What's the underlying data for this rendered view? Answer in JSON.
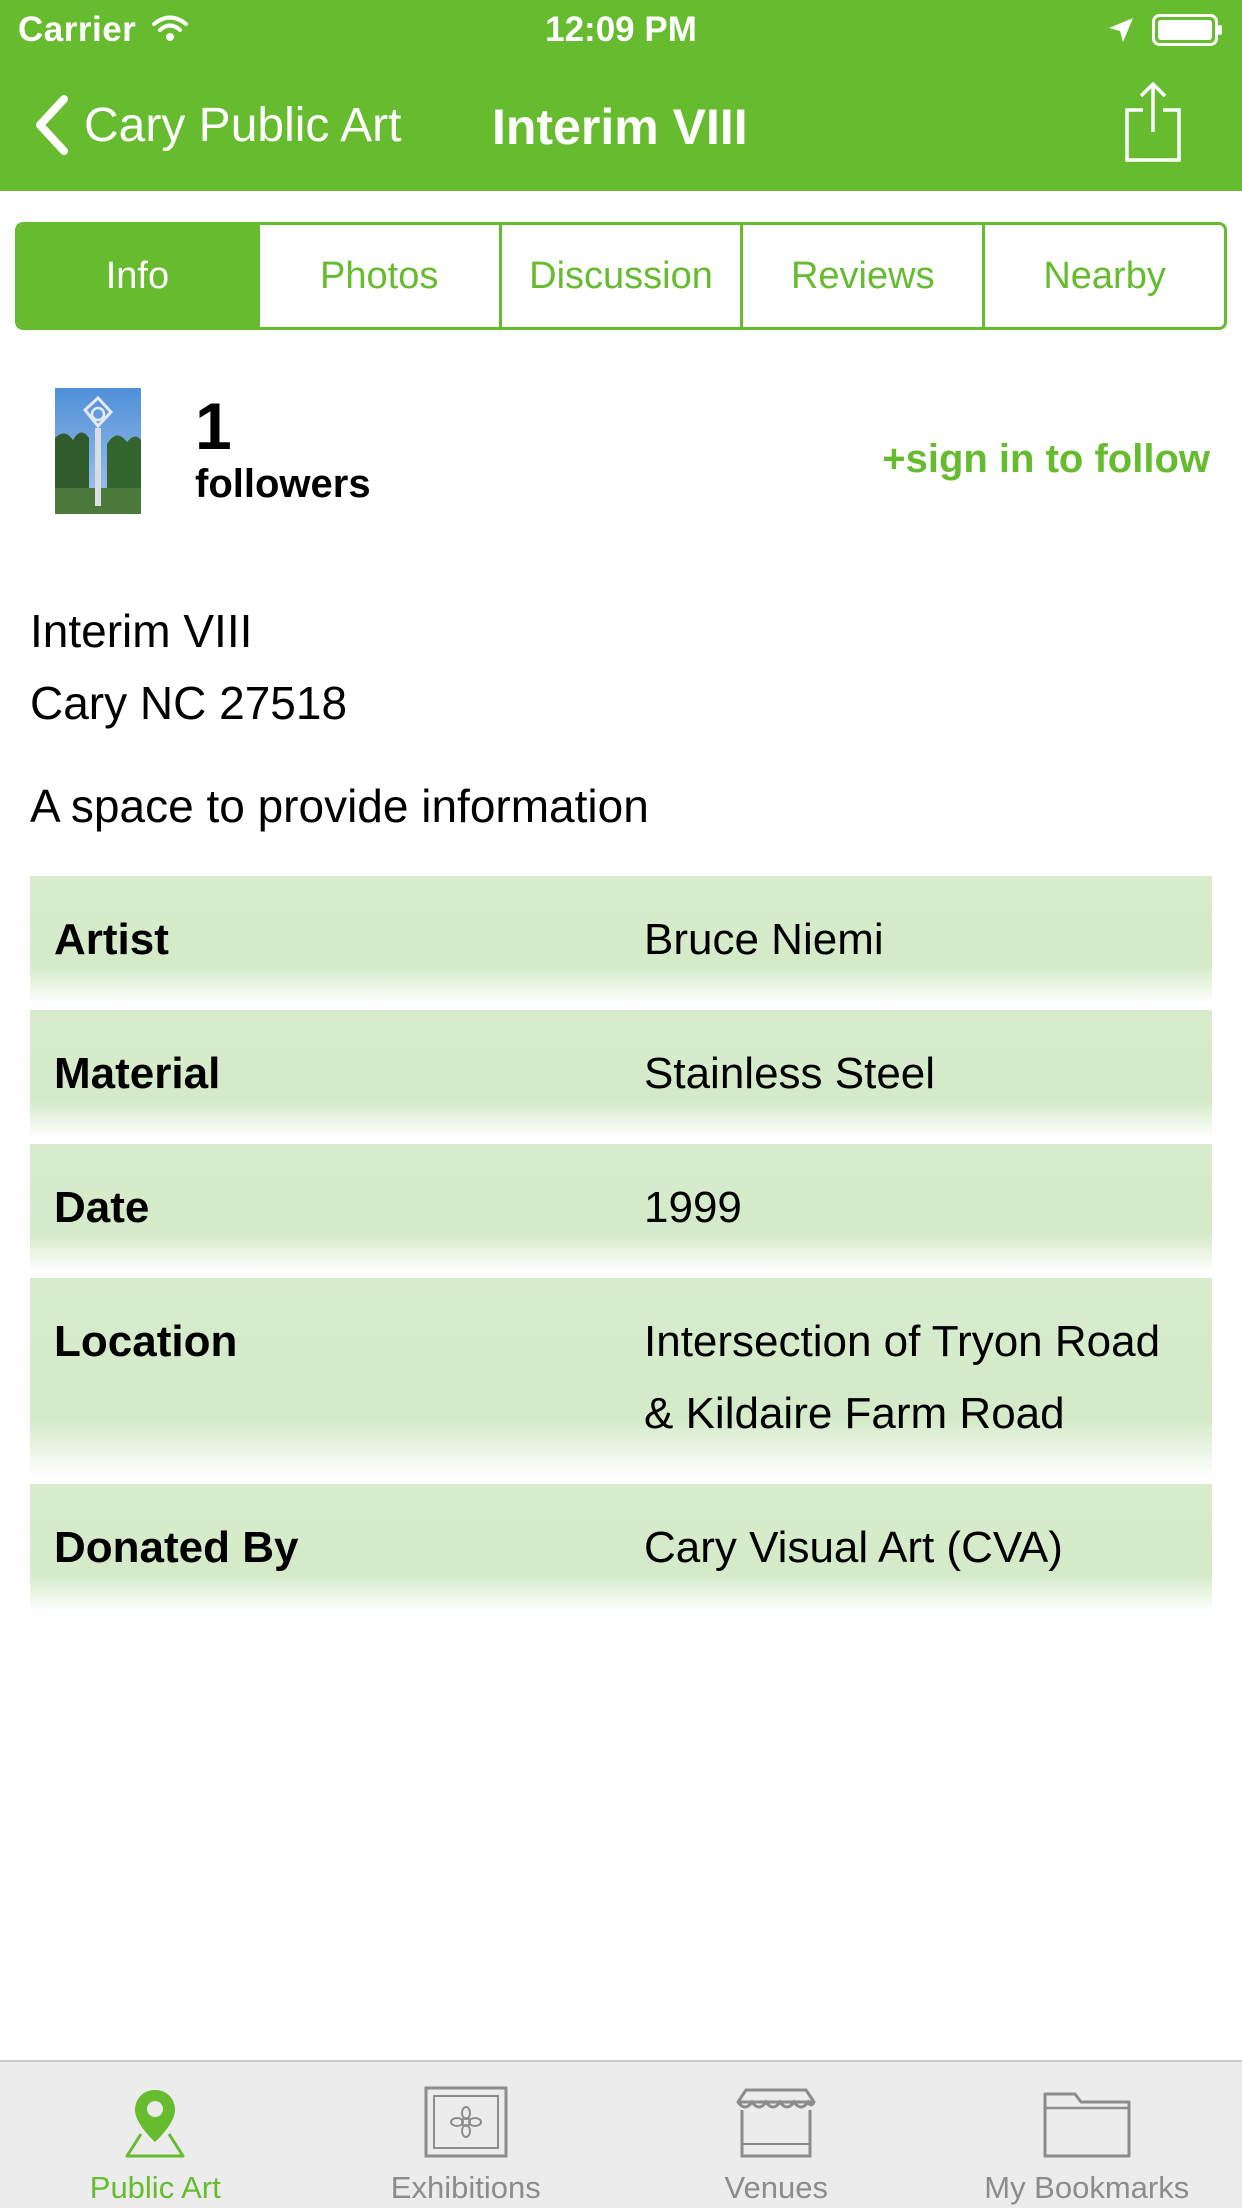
{
  "status_bar": {
    "carrier": "Carrier",
    "time": "12:09 PM",
    "icons": [
      "wifi-icon",
      "location-arrow-icon",
      "battery-icon"
    ]
  },
  "nav": {
    "back_label": "Cary Public Art",
    "title": "Interim VIII",
    "share_icon": "share-icon"
  },
  "tabs": [
    {
      "label": "Info",
      "active": true
    },
    {
      "label": "Photos",
      "active": false
    },
    {
      "label": "Discussion",
      "active": false
    },
    {
      "label": "Reviews",
      "active": false
    },
    {
      "label": "Nearby",
      "active": false
    }
  ],
  "follow": {
    "count": "1",
    "label": "followers",
    "action": "+sign in to follow"
  },
  "details": {
    "name": "Interim VIII",
    "city_line": "Cary NC 27518",
    "description": "A space to provide information"
  },
  "info_rows": [
    {
      "key": "Artist",
      "value": "Bruce Niemi"
    },
    {
      "key": "Material",
      "value": "Stainless Steel"
    },
    {
      "key": "Date",
      "value": "1999"
    },
    {
      "key": "Location",
      "value": "Intersection of Tryon Road & Kildaire Farm Road"
    },
    {
      "key": "Donated By",
      "value": "Cary Visual Art (CVA)"
    }
  ],
  "tab_bar": [
    {
      "label": "Public Art",
      "icon": "map-pin-icon",
      "active": true
    },
    {
      "label": "Exhibitions",
      "icon": "framed-art-icon",
      "active": false
    },
    {
      "label": "Venues",
      "icon": "storefront-icon",
      "active": false
    },
    {
      "label": "My Bookmarks",
      "icon": "folder-icon",
      "active": false
    }
  ],
  "colors": {
    "accent": "#66bb2e",
    "row_fill": "#d4eac8",
    "tab_bar_bg": "#ececec",
    "inactive_tab": "#8c8c8c"
  }
}
